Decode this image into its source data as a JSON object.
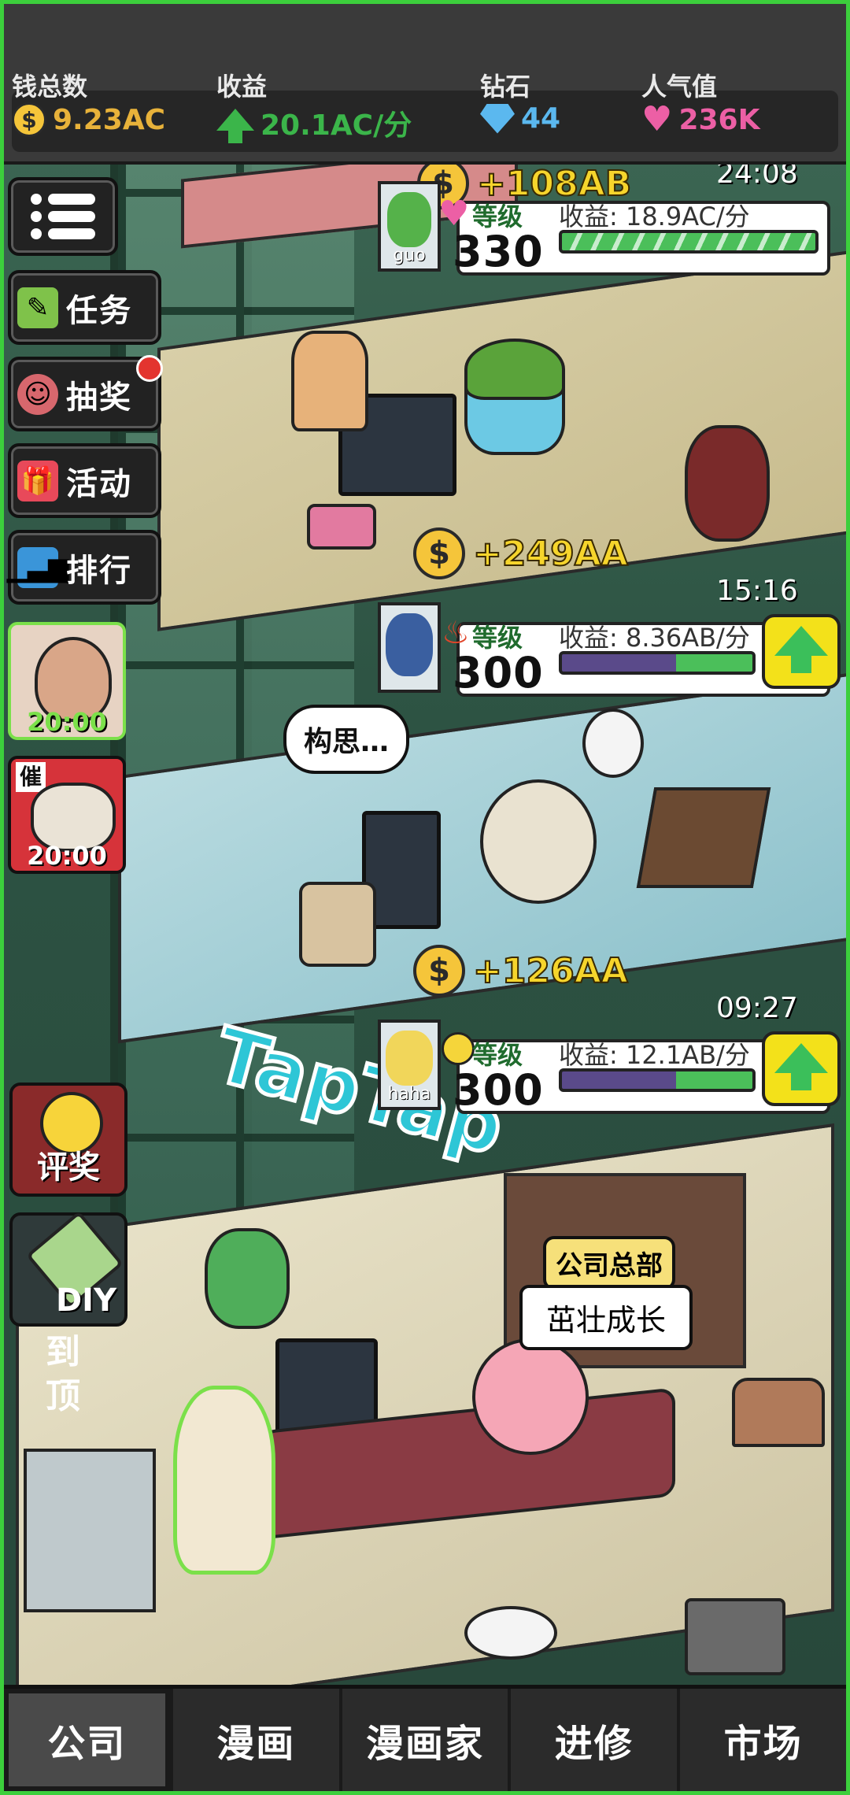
{
  "hud": {
    "money": {
      "label": "钱总数",
      "value": "9.23AC",
      "icon": "coin-icon"
    },
    "income": {
      "label": "收益",
      "value": "20.1AC/分",
      "icon": "arrow-up-icon"
    },
    "diamond": {
      "label": "钻石",
      "value": "44",
      "icon": "gem-icon"
    },
    "popularity": {
      "label": "人气值",
      "value": "236K",
      "icon": "heart-icon"
    }
  },
  "sidebar": {
    "menu_icon": "list-menu-icon",
    "items": [
      {
        "label": "任务",
        "icon": "clipboard-icon"
      },
      {
        "label": "抽奖",
        "icon": "lottery-icon",
        "badge": true
      },
      {
        "label": "活动",
        "icon": "gift-icon"
      },
      {
        "label": "排行",
        "icon": "bar-chart-icon"
      }
    ],
    "portraits": [
      {
        "timer": "20:00",
        "icon": "old-man-portrait"
      },
      {
        "timer": "20:00",
        "badge": "催",
        "icon": "characters-portrait"
      }
    ],
    "rate_label": "评奖",
    "diy_label": "DIY",
    "to_top_label": "到\n顶"
  },
  "floors": [
    {
      "earn": "+108AB",
      "timer": "24:08",
      "level_label": "等级",
      "level": "330",
      "income": "收益: 18.9AC/分",
      "progress": 1.0,
      "upgrade": false,
      "avatar_label": "guo"
    },
    {
      "earn": "+249AA",
      "timer": "15:16",
      "level_label": "等级",
      "level": "300",
      "income": "收益: 8.36AB/分",
      "progress": 0.4,
      "upgrade": true
    },
    {
      "earn": "+126AA",
      "timer": "09:27",
      "level_label": "等级",
      "level": "300",
      "income": "收益: 12.1AB/分",
      "progress": 0.4,
      "upgrade": true,
      "avatar_label": "haha"
    }
  ],
  "thought_bubble": "构思…",
  "hq": {
    "tag": "公司总部",
    "message": "茁壮成长"
  },
  "sign": "TapTap",
  "nav": {
    "tabs": [
      "公司",
      "漫画",
      "漫画家",
      "进修",
      "市场"
    ],
    "active": 0
  },
  "colors": {
    "accent": "#3bb54a",
    "coin": "#f5c53a",
    "gem": "#5bb8ef",
    "heart": "#ec5fa5"
  }
}
